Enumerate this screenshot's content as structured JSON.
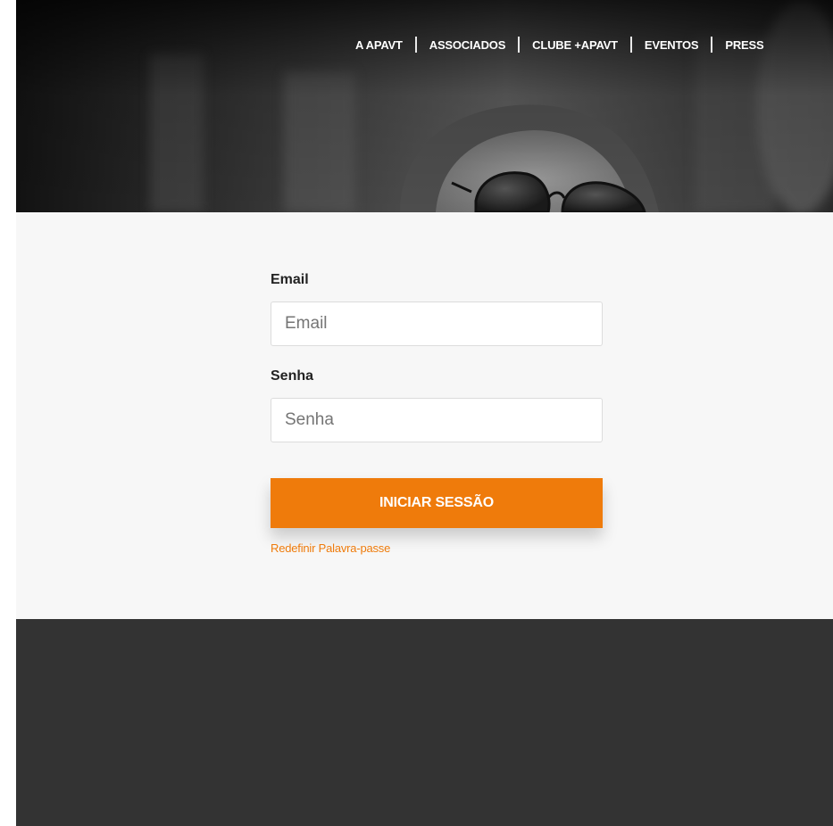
{
  "nav": {
    "items": [
      {
        "label": "A APAVT"
      },
      {
        "label": "ASSOCIADOS"
      },
      {
        "label": "CLUBE +APAVT"
      },
      {
        "label": "EVENTOS"
      },
      {
        "label": "PRESS"
      }
    ]
  },
  "login": {
    "email_label": "Email",
    "email_placeholder": "Email",
    "email_value": "",
    "password_label": "Senha",
    "password_placeholder": "Senha",
    "password_value": "",
    "submit_label": "INICIAR SESSÃO",
    "reset_link": "Redefinir Palavra-passe"
  },
  "colors": {
    "accent": "#ef7b0b",
    "hero_bg": "#2a2a2a",
    "section_bg": "#f7f7f7",
    "footer_bg": "#333333"
  },
  "icons": {
    "hero_image": "woman-with-sunglasses-photo"
  }
}
